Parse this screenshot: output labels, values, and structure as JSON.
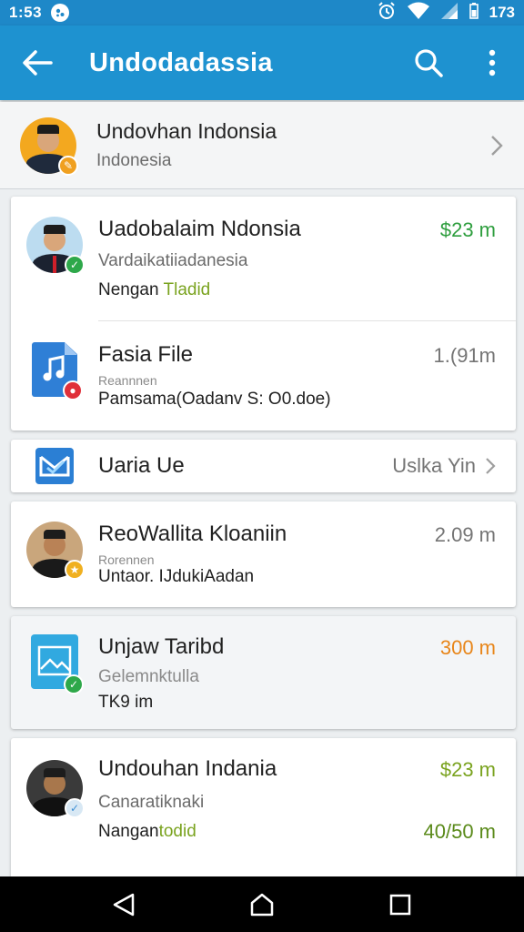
{
  "status_bar": {
    "time": "1:53",
    "battery": "173"
  },
  "app_bar": {
    "title": "Undodadassia"
  },
  "header": {
    "name": "Undovhan Indonsia",
    "subtitle": "Indonesia"
  },
  "items": [
    {
      "name": "Uadobalaim Ndonsia",
      "line2": "Vardaikatiiadanesia",
      "line3a": "Nengan ",
      "line3b": "Tladid",
      "meta": "$23 m"
    },
    {
      "name": "Fasia File",
      "small": "Reannnen",
      "line3": "Pamsama(Oadanv S: O0.doe)",
      "meta": "1.(91m"
    },
    {
      "name": "Uaria Ue",
      "meta": "Uslka Yin"
    },
    {
      "name": "ReoWallita Kloaniin",
      "small": "Rorennen",
      "line3": "Untaor. IJdukiAadan",
      "meta": "2.09 m"
    },
    {
      "name": "Unjaw Taribd",
      "line2": "Gelemnktulla",
      "line3": "TK9 im",
      "meta": "300 m"
    },
    {
      "name": "Undouhan Indania",
      "line2": "Canaratiknaki",
      "line3a": "Nangan",
      "line3b": "todid",
      "meta": "$23 m",
      "meta2": "40/50 m"
    }
  ],
  "colors": {
    "app_bar": "#1e92d0",
    "status_bar": "#1e88c8",
    "green": "#2e9e3e",
    "orange": "#e8861a"
  }
}
